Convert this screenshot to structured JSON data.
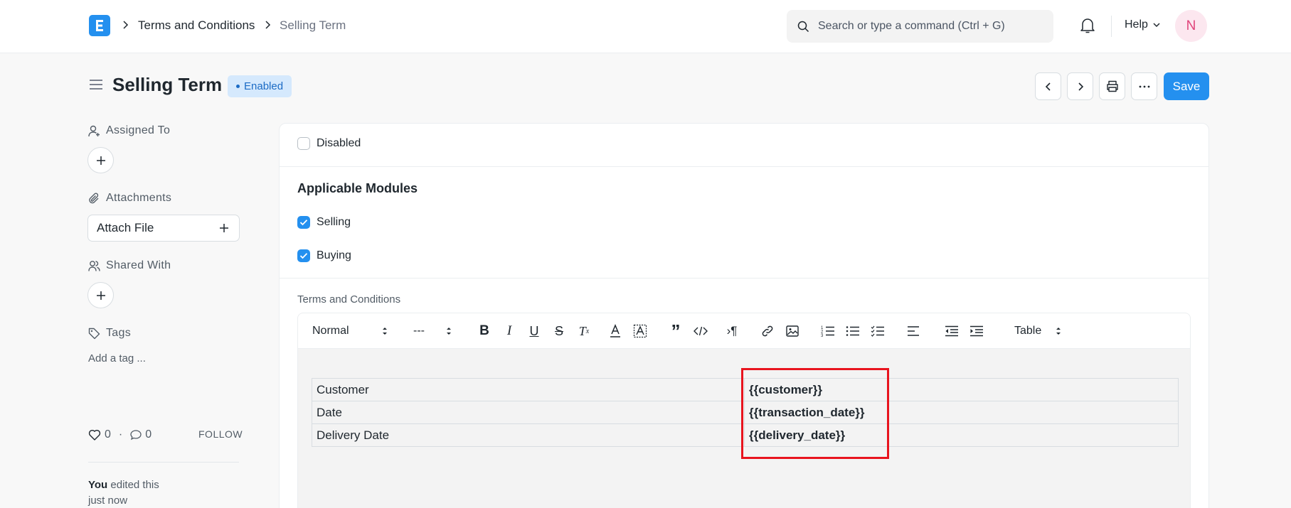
{
  "breadcrumb": {
    "parent": "Terms and Conditions",
    "current": "Selling Term"
  },
  "search": {
    "placeholder": "Search or type a command (Ctrl + G)"
  },
  "header": {
    "help_label": "Help",
    "avatar_initial": "N"
  },
  "page": {
    "title": "Selling Term",
    "status_badge": "Enabled",
    "save_label": "Save"
  },
  "sidebar": {
    "assigned_to": "Assigned To",
    "attachments": "Attachments",
    "attach_file": "Attach File",
    "shared_with": "Shared With",
    "tags": "Tags",
    "add_tag": "Add a tag ...",
    "likes": "0",
    "comments": "0",
    "follow": "FOLLOW",
    "activity_user": "You",
    "activity_text": "edited this",
    "activity_time": "just now"
  },
  "form": {
    "disabled_label": "Disabled",
    "disabled_checked": false,
    "section_title": "Applicable Modules",
    "selling_label": "Selling",
    "selling_checked": true,
    "buying_label": "Buying",
    "buying_checked": true,
    "terms_label": "Terms and Conditions"
  },
  "toolbar": {
    "format": "Normal",
    "size": "---",
    "table": "Table",
    "icons": [
      "bold-icon",
      "italic-icon",
      "underline-icon",
      "strike-icon",
      "clear-format-icon",
      "text-color-icon",
      "background-color-icon",
      "blockquote-icon",
      "code-icon",
      "direction-icon",
      "link-icon",
      "image-icon",
      "ordered-list-icon",
      "bullet-list-icon",
      "check-list-icon",
      "align-icon",
      "outdent-icon",
      "indent-icon"
    ]
  },
  "editor_table": {
    "rows": [
      {
        "label": "Customer",
        "value": "{{customer}}"
      },
      {
        "label": "Date",
        "value": "{{transaction_date}}"
      },
      {
        "label": "Delivery Date",
        "value": "{{delivery_date}}"
      }
    ]
  },
  "colors": {
    "accent": "#2490ef",
    "highlight": "#e8141e",
    "badge_bg": "#d5e9fd",
    "badge_text": "#1b6bc5"
  }
}
